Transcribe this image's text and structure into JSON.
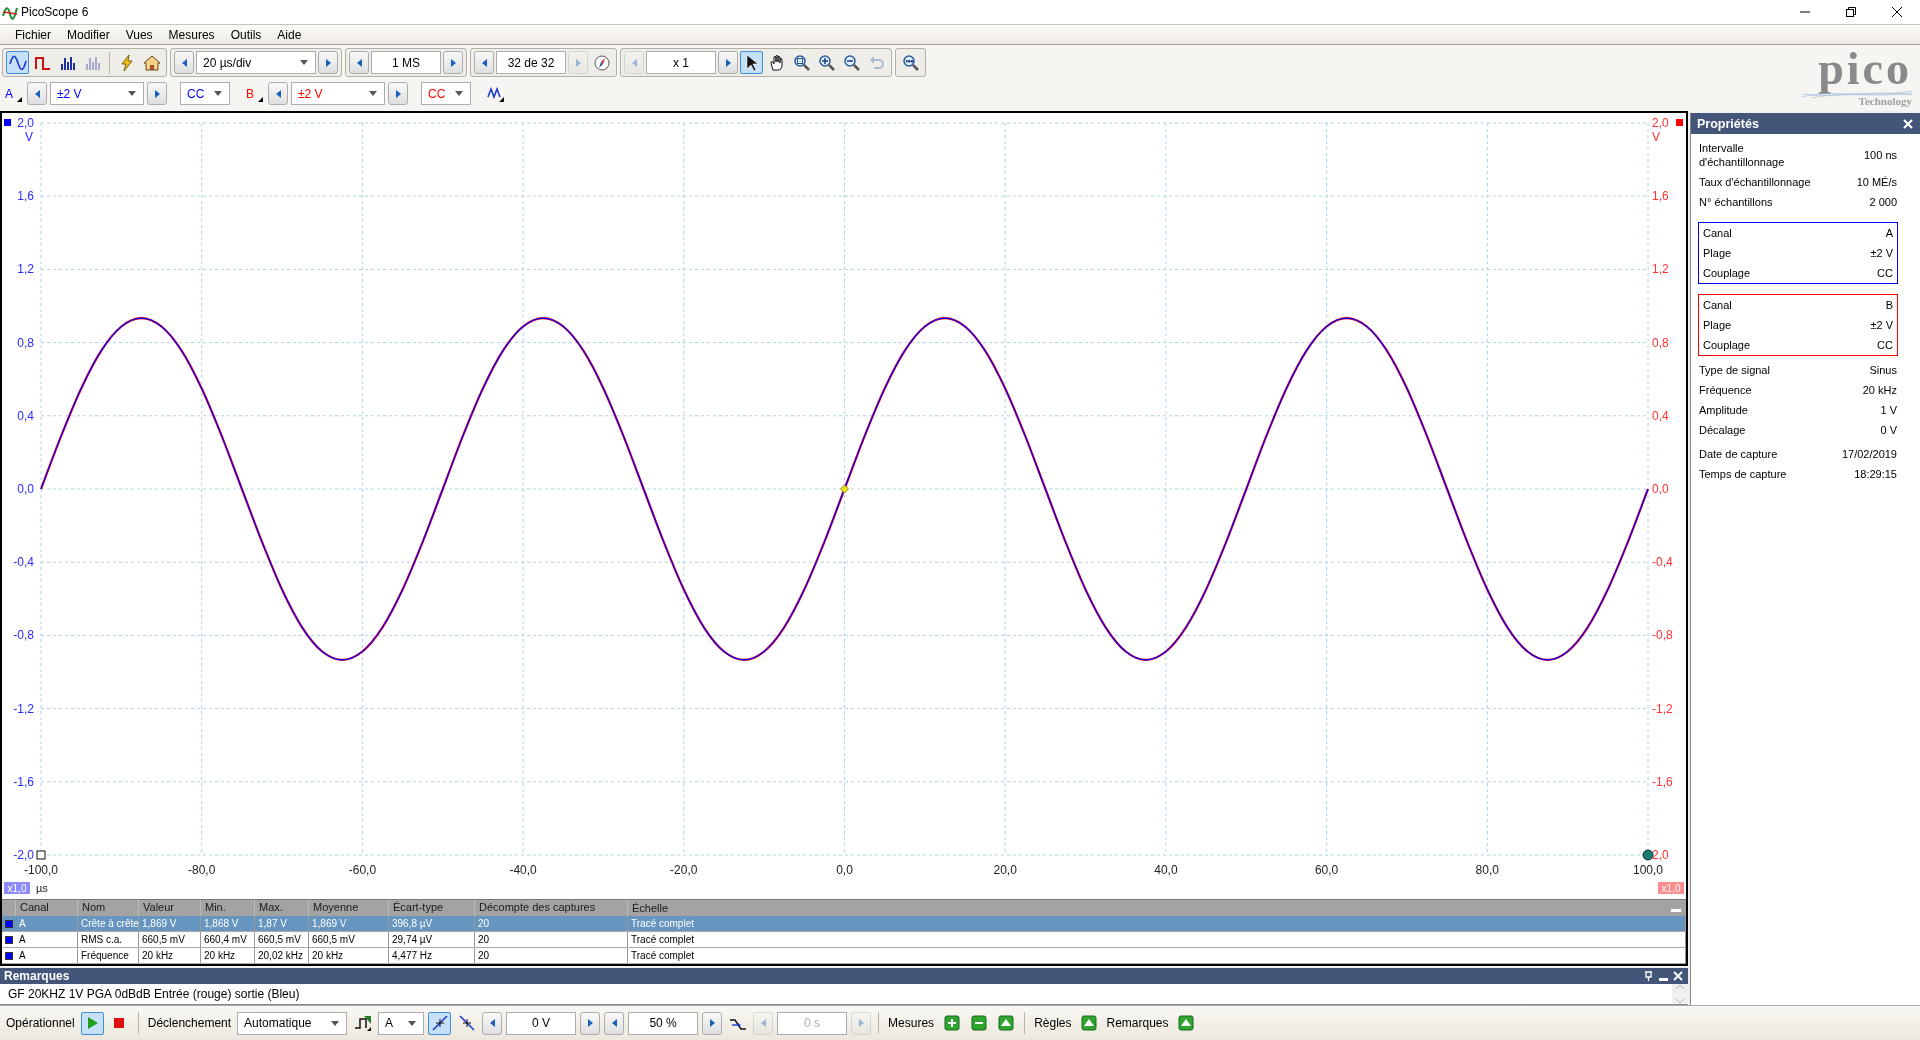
{
  "window": {
    "title": "PicoScope 6"
  },
  "menu": [
    "Fichier",
    "Modifier",
    "Vues",
    "Mesures",
    "Outils",
    "Aide"
  ],
  "toolbar": {
    "groups": [
      {
        "items": [
          {
            "kind": "scope",
            "selected": true,
            "disabled": false
          },
          {
            "kind": "persistence",
            "selected": false,
            "disabled": false
          },
          {
            "kind": "spectrum",
            "selected": false,
            "disabled": false
          },
          {
            "kind": "spectrum",
            "selected": false,
            "disabled": true
          },
          {
            "kind": "separator"
          },
          {
            "kind": "autosetup",
            "selected": false,
            "disabled": false
          },
          {
            "kind": "home",
            "selected": false,
            "disabled": false
          }
        ]
      },
      {
        "items": [
          {
            "kind": "stepper",
            "value": "20 µs/div",
            "dropdown": true,
            "disabled": false,
            "prev_disabled": false,
            "next_disabled": false
          }
        ]
      },
      {
        "items": [
          {
            "kind": "stepper",
            "value": "1 MS",
            "dropdown": false,
            "disabled": false,
            "prev_disabled": false,
            "next_disabled": false
          }
        ]
      },
      {
        "items": [
          {
            "kind": "stepper",
            "value": "32 de 32",
            "dropdown": false,
            "disabled": false,
            "prev_disabled": false,
            "next_disabled": true
          },
          {
            "kind": "navigator",
            "selected": false,
            "disabled": false
          }
        ]
      },
      {
        "items": [
          {
            "kind": "stepper",
            "value": "x 1",
            "dropdown": false,
            "disabled": false,
            "prev_disabled": true,
            "next_disabled": false
          },
          {
            "kind": "pointer",
            "selected": true,
            "disabled": false
          },
          {
            "kind": "hand",
            "selected": false,
            "disabled": false
          },
          {
            "kind": "zoombox",
            "selected": false,
            "disabled": false
          },
          {
            "kind": "zoomin",
            "selected": false,
            "disabled": false
          },
          {
            "kind": "zoomout",
            "selected": false,
            "disabled": false
          },
          {
            "kind": "undo",
            "selected": false,
            "disabled": true
          }
        ]
      },
      {
        "items": [
          {
            "kind": "zoomfit",
            "selected": false,
            "disabled": false
          }
        ]
      }
    ]
  },
  "channels": [
    {
      "name": "A",
      "color": "#0000ff",
      "range": "±2 V",
      "coupling": "CC"
    },
    {
      "name": "B",
      "color": "#ff0000",
      "range": "±2 V",
      "coupling": "CC"
    }
  ],
  "extra_tools": [
    {
      "kind": "siggen",
      "selected": false,
      "disabled": false
    }
  ],
  "logo": {
    "name": "pico",
    "tagline": "Technology"
  },
  "scope": {
    "chart_data": {
      "type": "line",
      "xlabel": "µs",
      "ylabel": "V",
      "x": [
        -100,
        -97.5,
        -95,
        -92.5,
        -90,
        -87.5,
        -85,
        -82.5,
        -80,
        -77.5,
        -75,
        -72.5,
        -70,
        -67.5,
        -65,
        -62.5,
        -60,
        -57.5,
        -55,
        -52.5,
        -50,
        -47.5,
        -45,
        -42.5,
        -40,
        -37.5,
        -35,
        -32.5,
        -30,
        -27.5,
        -25,
        -22.5,
        -20,
        -17.5,
        -15,
        -12.5,
        -10,
        -7.5,
        -5,
        -2.5,
        0,
        2.5,
        5,
        7.5,
        10,
        12.5,
        15,
        17.5,
        20,
        22.5,
        25,
        27.5,
        30,
        32.5,
        35,
        37.5,
        40,
        42.5,
        45,
        47.5,
        50,
        52.5,
        55,
        57.5,
        60,
        62.5,
        65,
        67.5,
        70,
        72.5,
        75,
        77.5,
        80,
        82.5,
        85,
        87.5,
        90,
        92.5,
        95,
        97.5,
        100
      ],
      "series": [
        {
          "color": "#ff0000",
          "values": [
            0,
            0.289,
            0.549,
            0.756,
            0.888,
            0.934,
            0.888,
            0.756,
            0.549,
            0.289,
            0,
            -0.289,
            -0.549,
            -0.756,
            -0.888,
            -0.934,
            -0.888,
            -0.756,
            -0.549,
            -0.289,
            0,
            0.289,
            0.549,
            0.756,
            0.888,
            0.934,
            0.888,
            0.756,
            0.549,
            0.289,
            0,
            -0.289,
            -0.549,
            -0.756,
            -0.888,
            -0.934,
            -0.888,
            -0.756,
            -0.549,
            -0.289,
            0,
            0.289,
            0.549,
            0.756,
            0.888,
            0.934,
            0.888,
            0.756,
            0.549,
            0.289,
            0,
            -0.289,
            -0.549,
            -0.756,
            -0.888,
            -0.934,
            -0.888,
            -0.756,
            -0.549,
            -0.289,
            0,
            0.289,
            0.549,
            0.756,
            0.888,
            0.934,
            0.888,
            0.756,
            0.549,
            0.289,
            0,
            -0.289,
            -0.549,
            -0.756,
            -0.888,
            -0.934,
            -0.888,
            -0.756,
            -0.549,
            -0.289,
            0
          ]
        },
        {
          "color": "#0000ff",
          "values": [
            0,
            0.289,
            0.549,
            0.756,
            0.888,
            0.934,
            0.888,
            0.756,
            0.549,
            0.289,
            0,
            -0.289,
            -0.549,
            -0.756,
            -0.888,
            -0.934,
            -0.888,
            -0.756,
            -0.549,
            -0.289,
            0,
            0.289,
            0.549,
            0.756,
            0.888,
            0.934,
            0.888,
            0.756,
            0.549,
            0.289,
            0,
            -0.289,
            -0.549,
            -0.756,
            -0.888,
            -0.934,
            -0.888,
            -0.756,
            -0.549,
            -0.289,
            0,
            0.289,
            0.549,
            0.756,
            0.888,
            0.934,
            0.888,
            0.756,
            0.549,
            0.289,
            0,
            -0.289,
            -0.549,
            -0.756,
            -0.888,
            -0.934,
            -0.888,
            -0.756,
            -0.549,
            -0.289,
            0,
            0.289,
            0.549,
            0.756,
            0.888,
            0.934,
            0.888,
            0.756,
            0.549,
            0.289,
            0,
            -0.289,
            -0.549,
            -0.756,
            -0.888,
            -0.934,
            -0.888,
            -0.756,
            -0.549,
            -0.289,
            0
          ]
        }
      ],
      "xlim": [
        -100,
        100
      ],
      "ylim": [
        -2,
        2
      ],
      "xticks": [
        {
          "value": -100,
          "label": "-100,0"
        },
        {
          "value": -80,
          "label": "-80,0"
        },
        {
          "value": -60,
          "label": "-60,0"
        },
        {
          "value": -40,
          "label": "-40,0"
        },
        {
          "value": -20,
          "label": "-20,0"
        },
        {
          "value": 0,
          "label": "0,0"
        },
        {
          "value": 20,
          "label": "20,0"
        },
        {
          "value": 40,
          "label": "40,0"
        },
        {
          "value": 60,
          "label": "60,0"
        },
        {
          "value": 80,
          "label": "80,0"
        },
        {
          "value": 100,
          "label": "100,0"
        }
      ],
      "yticks": [
        {
          "value": 2,
          "label": "2,0"
        },
        {
          "value": 1.6,
          "label": "1,6"
        },
        {
          "value": 1.2,
          "label": "1,2"
        },
        {
          "value": 0.8,
          "label": "0,8"
        },
        {
          "value": 0.4,
          "label": "0,4"
        },
        {
          "value": 0,
          "label": "0,0"
        },
        {
          "value": -0.4,
          "label": "-0,4"
        },
        {
          "value": -0.8,
          "label": "-0,8"
        },
        {
          "value": -1.2,
          "label": "-1,2"
        },
        {
          "value": -1.6,
          "label": "-1,6"
        },
        {
          "value": -2,
          "label": "-2,0"
        }
      ],
      "grid": true
    },
    "right_axis": {
      "unit": "V",
      "ticks": [
        "2,0",
        "1,6",
        "1,2",
        "0,8",
        "0,4",
        "0,0",
        "-0,4",
        "-0,8",
        "-1,2",
        "-1,6",
        "2,0"
      ]
    },
    "scale_badges": [
      {
        "label": "x1,0",
        "color": "#8c8cff"
      },
      {
        "label": "x1,0",
        "color": "#ff8c8c"
      }
    ]
  },
  "measurements": {
    "columns": [
      "Canal",
      "Nom",
      "Valeur",
      "Min.",
      "Max.",
      "Moyenne",
      "Écart-type",
      "Décompte des captures",
      "Échelle"
    ],
    "rows": [
      {
        "selected": true,
        "color": "#0000ff",
        "cells": [
          "A",
          "Crête à crête",
          "1,869 V",
          "1,868 V",
          "1,87 V",
          "1,869 V",
          "396,8 µV",
          "20",
          "Tracé complet"
        ]
      },
      {
        "selected": false,
        "color": "#0000ff",
        "cells": [
          "A",
          "RMS c.a.",
          "660,5 mV",
          "660,4 mV",
          "660,5 mV",
          "660,5 mV",
          "29,74 µV",
          "20",
          "Tracé complet"
        ]
      },
      {
        "selected": false,
        "color": "#0000ff",
        "cells": [
          "A",
          "Fréquence",
          "20 kHz",
          "20 kHz",
          "20,02 kHz",
          "20 kHz",
          "4,477 Hz",
          "20",
          "Tracé complet"
        ]
      }
    ]
  },
  "notes": {
    "title": "Remarques",
    "text": "GF 20KHZ 1V PGA 0dBdB Entrée (rouge) sortie (Bleu)"
  },
  "properties": {
    "title": "Propriétés",
    "sections": [
      {
        "kind": "plain",
        "rows": [
          {
            "label": "Intervalle d'échantillonnage",
            "value": "100 ns"
          },
          {
            "label": "Taux d'échantillonnage",
            "value": "10 MÉ/s"
          },
          {
            "label": "N° échantillons",
            "value": "2 000"
          }
        ]
      },
      {
        "kind": "channel",
        "color": "#0000ff",
        "rows": [
          {
            "label": "Canal",
            "value": "A"
          },
          {
            "label": "Plage",
            "value": "±2 V"
          },
          {
            "label": "Couplage",
            "value": "CC"
          }
        ]
      },
      {
        "kind": "channel",
        "color": "#ff0000",
        "rows": [
          {
            "label": "Canal",
            "value": "B"
          },
          {
            "label": "Plage",
            "value": "±2 V"
          },
          {
            "label": "Couplage",
            "value": "CC"
          }
        ]
      },
      {
        "kind": "plain",
        "rows": [
          {
            "label": "Type de signal",
            "value": "Sinus"
          },
          {
            "label": "Fréquence",
            "value": "20 kHz"
          },
          {
            "label": "Amplitude",
            "value": "1 V"
          },
          {
            "label": "Décalage",
            "value": "0 V"
          }
        ]
      },
      {
        "kind": "plain",
        "rows": [
          {
            "label": "Date de capture",
            "value": "17/02/2019"
          },
          {
            "label": "Temps de capture",
            "value": "18:29:15"
          }
        ]
      }
    ]
  },
  "status_bar": [
    {
      "kind": "label",
      "text": "Opérationnel"
    },
    {
      "kind": "play",
      "selected": true,
      "disabled": false
    },
    {
      "kind": "stop",
      "selected": false,
      "disabled": false
    },
    {
      "kind": "separator"
    },
    {
      "kind": "label",
      "text": "Déclenchement"
    },
    {
      "kind": "dropdown",
      "value": "Automatique"
    },
    {
      "kind": "triggersetup",
      "selected": false,
      "disabled": false
    },
    {
      "kind": "dropdown",
      "value": "A"
    },
    {
      "kind": "rising",
      "selected": true,
      "disabled": false
    },
    {
      "kind": "falling",
      "selected": false,
      "disabled": false
    },
    {
      "kind": "stepper",
      "value": "0 V",
      "dropdown": false,
      "disabled": false,
      "prev_disabled": false,
      "next_disabled": false
    },
    {
      "kind": "stepper",
      "value": "50 %",
      "dropdown": false,
      "disabled": false,
      "prev_disabled": false,
      "next_disabled": false
    },
    {
      "kind": "pretrigger",
      "selected": false,
      "disabled": false
    },
    {
      "kind": "stepper",
      "value": "0 s",
      "dropdown": false,
      "disabled": true,
      "prev_disabled": true,
      "next_disabled": true
    },
    {
      "kind": "separator"
    },
    {
      "kind": "label",
      "text": "Mesures"
    },
    {
      "kind": "add",
      "selected": false,
      "disabled": false
    },
    {
      "kind": "remove",
      "selected": false,
      "disabled": false
    },
    {
      "kind": "edit",
      "selected": false,
      "disabled": false
    },
    {
      "kind": "separator"
    },
    {
      "kind": "label",
      "text": "Règles"
    },
    {
      "kind": "edit",
      "selected": false,
      "disabled": false
    },
    {
      "kind": "label",
      "text": "Remarques"
    },
    {
      "kind": "edit",
      "selected": false,
      "disabled": false
    }
  ]
}
